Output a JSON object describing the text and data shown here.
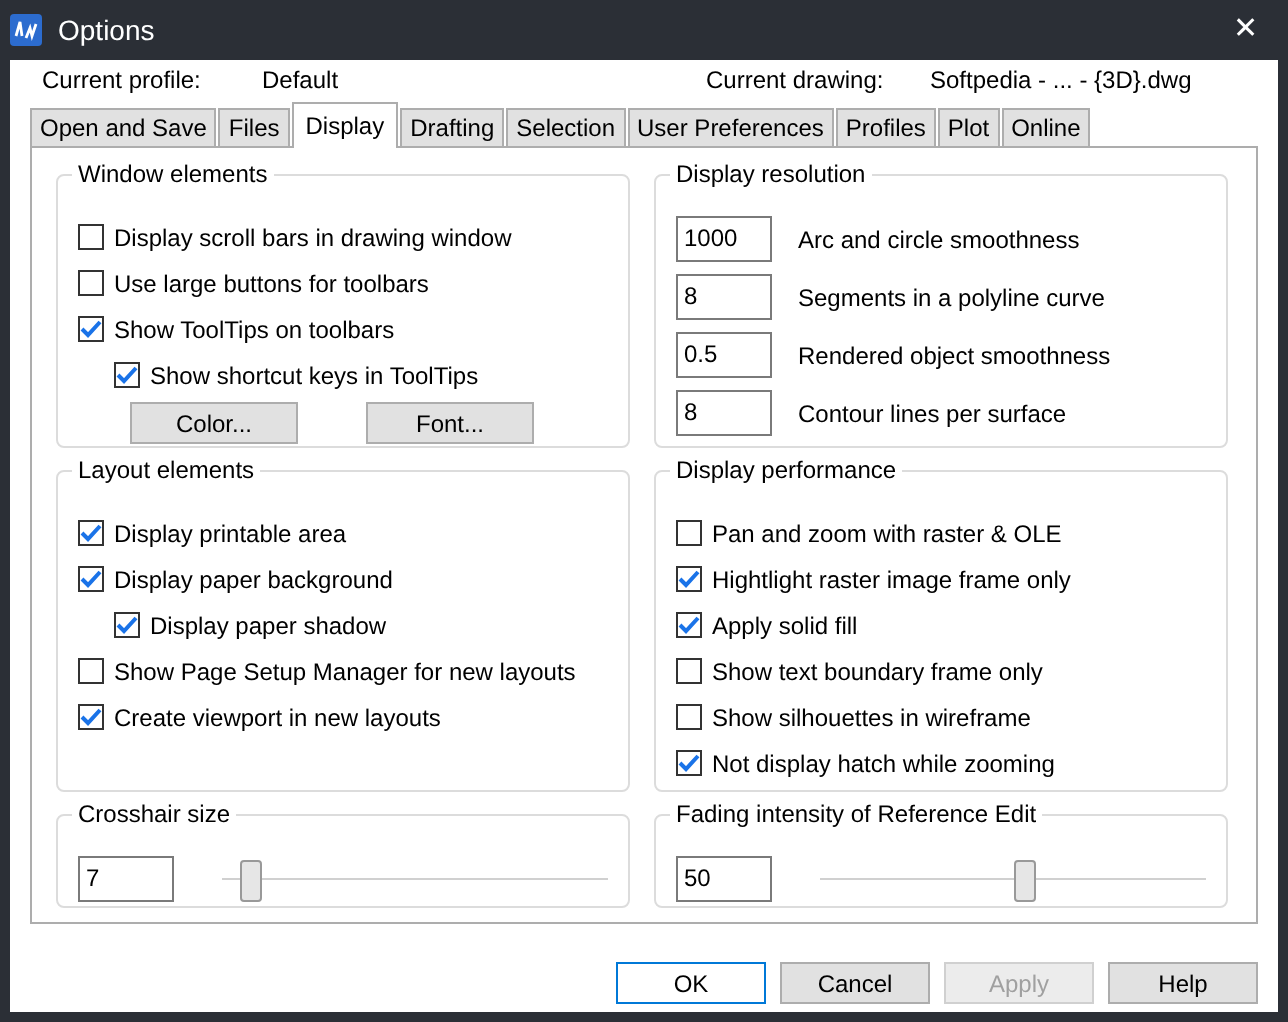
{
  "window": {
    "title": "Options",
    "close": "✕"
  },
  "profile": {
    "label": "Current profile:",
    "value": "Default",
    "drawing_label": "Current drawing:",
    "drawing_value": "Softpedia - ... - {3D}.dwg"
  },
  "tabs": [
    {
      "label": "Open and Save",
      "selected": false
    },
    {
      "label": "Files",
      "selected": false
    },
    {
      "label": "Display",
      "selected": true
    },
    {
      "label": "Drafting",
      "selected": false
    },
    {
      "label": "Selection",
      "selected": false
    },
    {
      "label": "User Preferences",
      "selected": false
    },
    {
      "label": "Profiles",
      "selected": false
    },
    {
      "label": "Plot",
      "selected": false
    },
    {
      "label": "Online",
      "selected": false
    }
  ],
  "window_elements": {
    "title": "Window elements",
    "options": [
      {
        "label": "Display scroll bars in drawing window",
        "checked": false
      },
      {
        "label": "Use large buttons for toolbars",
        "checked": false
      },
      {
        "label": "Show ToolTips on toolbars",
        "checked": true,
        "children": [
          {
            "label": "Show shortcut keys in ToolTips",
            "checked": true
          }
        ]
      }
    ],
    "buttons": [
      "Color...",
      "Font..."
    ]
  },
  "display_resolution": {
    "title": "Display resolution",
    "fields": [
      {
        "value": "1000",
        "label": "Arc and circle smoothness"
      },
      {
        "value": "8",
        "label": "Segments in a polyline curve"
      },
      {
        "value": "0.5",
        "label": "Rendered object smoothness"
      },
      {
        "value": "8",
        "label": "Contour lines per surface"
      }
    ]
  },
  "layout_elements": {
    "title": "Layout elements",
    "options": [
      {
        "label": "Display printable area",
        "checked": true
      },
      {
        "label": "Display paper background",
        "checked": true,
        "children": [
          {
            "label": "Display paper shadow",
            "checked": true
          }
        ]
      },
      {
        "label": "Show Page Setup Manager for new layouts",
        "checked": false
      },
      {
        "label": "Create viewport in new layouts",
        "checked": true
      }
    ]
  },
  "display_performance": {
    "title": "Display performance",
    "options": [
      {
        "label": "Pan and zoom with raster & OLE",
        "checked": false
      },
      {
        "label": "Hightlight raster image frame only",
        "checked": true
      },
      {
        "label": "Apply solid fill",
        "checked": true
      },
      {
        "label": "Show text boundary frame only",
        "checked": false
      },
      {
        "label": "Show silhouettes in wireframe",
        "checked": false
      },
      {
        "label": "Not display hatch while zooming",
        "checked": true
      }
    ]
  },
  "crosshair": {
    "title": "Crosshair size",
    "value": "7",
    "level": 0.07
  },
  "fading": {
    "title": "Fading intensity of Reference Edit",
    "value": "50",
    "level": 0.53
  },
  "buttons": [
    {
      "label": "OK",
      "disabled": false,
      "default": true
    },
    {
      "label": "Cancel",
      "disabled": false,
      "default": false
    },
    {
      "label": "Apply",
      "disabled": true,
      "default": false
    },
    {
      "label": "Help",
      "disabled": false,
      "default": false
    }
  ]
}
